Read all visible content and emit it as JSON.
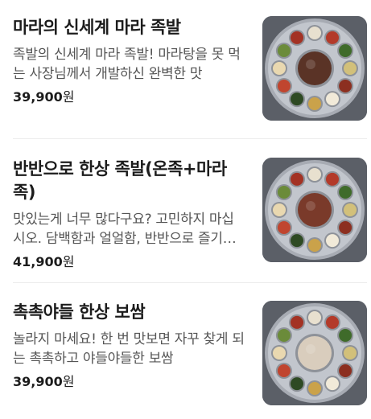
{
  "items": [
    {
      "title": "마라의 신세계 마라 족발",
      "description": "족발의 신세계 마라 족발! 마라탕을 못 먹는 사장님께서 개발하신 완벽한 맛",
      "price": "39,900",
      "currency": "원",
      "image_icon": "food-platter-image",
      "center_color": "#5a3326"
    },
    {
      "title": "반반으로 한상 족발(온족+마라족)",
      "description": "맛있는게 너무 많다구요? 고민하지 마십시오. 담백함과 얼얼함, 반반으로 즐기세요",
      "price": "41,900",
      "currency": "원",
      "image_icon": "food-platter-image",
      "center_color": "#7a3a2a"
    },
    {
      "title": "촉촉야들 한상 보쌈",
      "description": "놀라지 마세요! 한 번 맛보면 자꾸 찾게 되는 촉촉하고 야들야들한 보쌈",
      "price": "39,900",
      "currency": "원",
      "image_icon": "food-platter-image",
      "center_color": "#d9cdbd"
    }
  ]
}
